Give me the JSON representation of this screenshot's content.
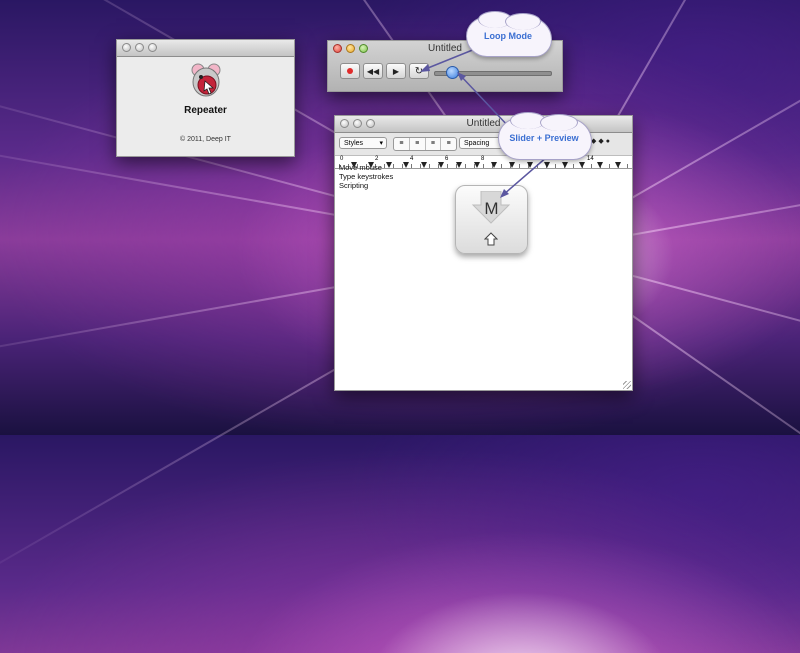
{
  "about_window": {
    "app_name": "Repeater",
    "copyright": "© 2011, Deep IT",
    "icon": "repeater-mouse-icon"
  },
  "player_window": {
    "title": "Untitled",
    "buttons": {
      "record": "record-icon",
      "rewind": "rewind-icon",
      "play": "play-icon",
      "loop": "loop-icon"
    }
  },
  "editor_window": {
    "title": "Untitled",
    "toolbar": {
      "styles_label": "Styles",
      "spacing_label": "Spacing"
    },
    "ruler_numbers": [
      "0",
      "2",
      "4",
      "6",
      "8",
      "14"
    ],
    "lines": [
      "Move mouse",
      "Type keystrokes",
      "Scripting"
    ]
  },
  "key_preview": {
    "letter": "M",
    "modifier": "shift-icon"
  },
  "callouts": {
    "loop": "Loop Mode",
    "slider": "Slider + Preview"
  },
  "colors": {
    "callout_text": "#3b6fd2",
    "record_red": "#e02b2b",
    "slider_knob": "#3b7fe0"
  }
}
